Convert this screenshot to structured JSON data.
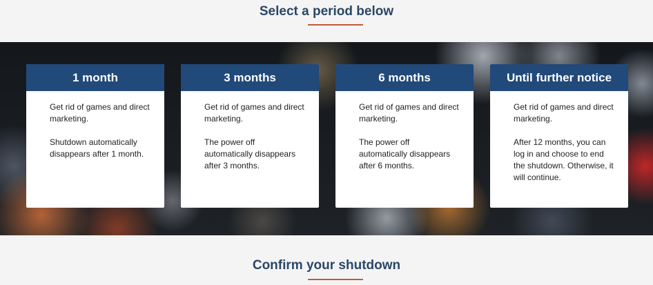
{
  "header": {
    "title": "Select a period below"
  },
  "periods": [
    {
      "title": "1 month",
      "line1": "Get rid of games and direct marketing.",
      "line2": "Shutdown automatically disappears after 1 month."
    },
    {
      "title": "3 months",
      "line1": "Get rid of games and direct marketing.",
      "line2": "The power off automatically disappears after 3 months."
    },
    {
      "title": "6 months",
      "line1": "Get rid of games and direct marketing.",
      "line2": "The power off automatically disappears after 6 months."
    },
    {
      "title": "Until further notice",
      "line1": "Get rid of games and direct marketing.",
      "line2": "After 12 months, you can log in and choose to end the shutdown. Otherwise, it will continue."
    }
  ],
  "confirm": {
    "title": "Confirm your shutdown"
  },
  "colors": {
    "title_text": "#2a4766",
    "accent_underline": "#c25a36",
    "card_header": "#21497a",
    "card_background": "#ffffff",
    "page_background": "#f4f4f4"
  }
}
